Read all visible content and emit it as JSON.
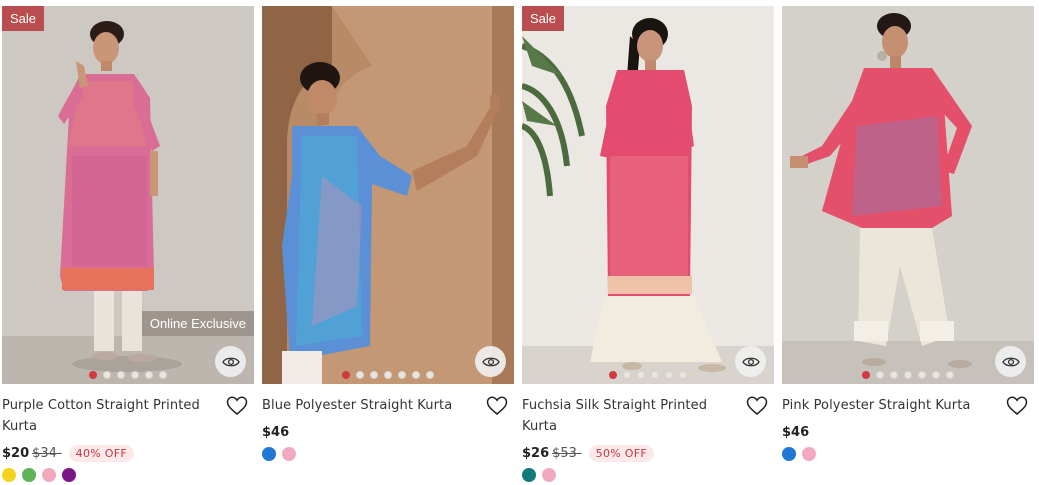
{
  "colors": {
    "accent": "#d0393e",
    "sale_badge_bg": "#b94d50",
    "off_badge_bg": "#fde9ea",
    "off_badge_text": "#c0393e"
  },
  "products": [
    {
      "title": "Purple Cotton Straight Printed Kurta",
      "price": "$20",
      "old_price": "$34-",
      "discount": "40% OFF",
      "sale_badge": "Sale",
      "exclusive_badge": "Online Exclusive",
      "image_dots": 6,
      "active_dot": 0,
      "swatches": [
        "#f2d41c",
        "#5fb257",
        "#f2a9c0",
        "#7a1785"
      ],
      "icons": [
        "eye-icon",
        "heart-icon"
      ]
    },
    {
      "title": "Blue Polyester Straight Kurta",
      "price": "$46",
      "old_price": "",
      "discount": "",
      "sale_badge": "",
      "exclusive_badge": "",
      "image_dots": 7,
      "active_dot": 0,
      "swatches": [
        "#1f77d4",
        "#f2a9c0"
      ],
      "icons": [
        "eye-icon",
        "heart-icon"
      ]
    },
    {
      "title": "Fuchsia Silk Straight Printed Kurta",
      "price": "$26",
      "old_price": "$53-",
      "discount": "50% OFF",
      "sale_badge": "Sale",
      "exclusive_badge": "",
      "image_dots": 6,
      "active_dot": 0,
      "swatches": [
        "#127a7a",
        "#f2a9c0"
      ],
      "icons": [
        "eye-icon",
        "heart-icon"
      ]
    },
    {
      "title": "Pink Polyester Straight Kurta",
      "price": "$46",
      "old_price": "",
      "discount": "",
      "sale_badge": "",
      "exclusive_badge": "",
      "image_dots": 7,
      "active_dot": 0,
      "swatches": [
        "#1f77d4",
        "#f2a9c0"
      ],
      "icons": [
        "eye-icon",
        "heart-icon"
      ]
    }
  ]
}
